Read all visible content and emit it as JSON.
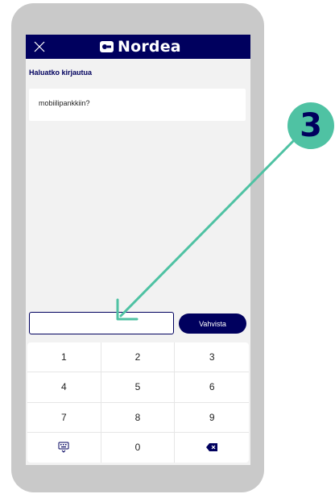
{
  "colors": {
    "brand_navy": "#00005e",
    "annotation_green": "#4fc2a3",
    "screen_bg": "#f2f2f2",
    "phone_frame": "#c9c9c9"
  },
  "header": {
    "brand": "Nordea",
    "close_icon": "close-icon",
    "logo_icon": "nordea-logo-icon"
  },
  "prompt": {
    "title": "Haluatko kirjautua",
    "message": "mobiilipankkiin?"
  },
  "pin": {
    "value": "",
    "confirm_label": "Vahvista"
  },
  "keypad": {
    "keys": [
      "1",
      "2",
      "3",
      "4",
      "5",
      "6",
      "7",
      "8",
      "9"
    ],
    "zero": "0",
    "keyboard_icon": "keyboard-icon",
    "backspace_icon": "backspace-icon"
  },
  "annotation": {
    "step_number": "3",
    "arrow_icon": "arrow-pointer-icon"
  }
}
